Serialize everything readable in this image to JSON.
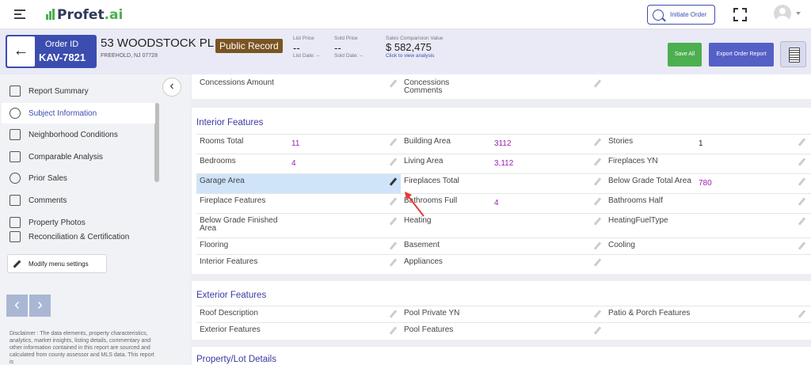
{
  "brand": {
    "name": "Profet",
    "suffix": ".ai"
  },
  "header": {
    "initiate_label": "Initiate Order"
  },
  "order": {
    "id_label": "Order ID",
    "id": "KAV-7821",
    "address": "53 WOODSTOCK PL",
    "city": "FREEHOLD, NJ 07728",
    "badge": "Public Record",
    "list_price_label": "List Price",
    "list_price": "--",
    "list_date": "List Date: --",
    "sold_price_label": "Sold Price",
    "sold_price": "--",
    "sold_date": "Sold Date: --",
    "scv_label": "Sales Comparision Value",
    "scv": "$ 582,475",
    "scv_link": "Click to view analysis",
    "save_all": "Save All",
    "export": "Export Order Report"
  },
  "sidebar": {
    "items": [
      {
        "label": "Report Summary"
      },
      {
        "label": "Subject Information"
      },
      {
        "label": "Neighborhood Conditions"
      },
      {
        "label": "Comparable Analysis"
      },
      {
        "label": "Prior Sales"
      },
      {
        "label": "Comments"
      },
      {
        "label": "Property Photos"
      },
      {
        "label": "Reconciliation & Certification"
      }
    ],
    "modify": "Modify menu settings",
    "disclaimer": "Disclaimer : The data elements, property characteristics, analytics, market insights, listing details, commentary and other information contained in this report are sourced and calculated from county assessor and MLS data. This report is"
  },
  "top_card": {
    "c1": "Concessions Amount",
    "c2": "Concessions Comments"
  },
  "interior": {
    "title": "Interior Features",
    "rooms_total": "Rooms Total",
    "rooms_total_v": "11",
    "building_area": "Building Area",
    "building_area_v": "3112",
    "stories": "Stories",
    "stories_v": "1",
    "bedrooms": "Bedrooms",
    "bedrooms_v": "4",
    "living_area": "Living Area",
    "living_area_v": "3,112",
    "fireplaces_yn": "Fireplaces YN",
    "garage_area": "Garage Area",
    "fireplaces_total": "Fireplaces Total",
    "below_grade_total": "Below Grade Total Area",
    "below_grade_total_v": "780",
    "fireplace_features": "Fireplace Features",
    "bathrooms_full": "Bathrooms Full",
    "bathrooms_full_v": "4",
    "bathrooms_half": "Bathrooms Half",
    "below_grade_finished": "Below Grade Finished Area",
    "heating": "Heating",
    "heating_fuel": "HeatingFuelType",
    "flooring": "Flooring",
    "basement": "Basement",
    "cooling": "Cooling",
    "interior_features": "Interior Features",
    "appliances": "Appliances"
  },
  "exterior": {
    "title": "Exterior Features",
    "roof": "Roof Description",
    "pool_private": "Pool Private YN",
    "patio": "Patio & Porch Features",
    "ext_features": "Exterior Features",
    "pool_features": "Pool Features"
  },
  "lot": {
    "title": "Property/Lot Details"
  }
}
